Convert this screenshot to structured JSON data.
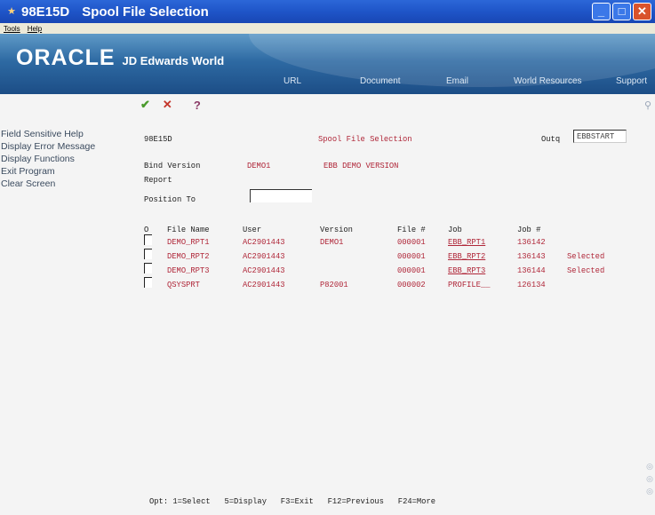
{
  "window": {
    "code": "98E15D",
    "title": "Spool File Selection"
  },
  "menubar": {
    "tools": "Tools",
    "help": "Help"
  },
  "brand": {
    "logo": "ORACLE",
    "product": "JD Edwards World"
  },
  "nav": [
    "URL",
    "Document",
    "Email",
    "World Resources",
    "Support"
  ],
  "sidebar": [
    "Field Sensitive Help",
    "Display Error Message",
    "Display Functions",
    "Exit Program",
    "Clear Screen"
  ],
  "form": {
    "id": "98E15D",
    "title": "Spool File Selection",
    "outq_label": "Outq",
    "outq_value": "EBBSTART",
    "bind_version_label": "Bind Version",
    "bind_version_value": "DEMO1",
    "bind_version_desc": "EBB DEMO VERSION",
    "report_label": "Report",
    "position_to_label": "Position To",
    "position_to_value": ""
  },
  "table": {
    "headers": [
      "O",
      "File Name",
      "User",
      "Version",
      "File #",
      "Job",
      "Job #"
    ],
    "rows": [
      {
        "file_name": "DEMO_RPT1",
        "user": "AC2901443",
        "version": "DEMO1",
        "file_no": "000001",
        "job": "EBB_RPT1",
        "job_no": "136142",
        "status": ""
      },
      {
        "file_name": "DEMO_RPT2",
        "user": "AC2901443",
        "version": "",
        "file_no": "000001",
        "job": "EBB_RPT2",
        "job_no": "136143",
        "status": "Selected"
      },
      {
        "file_name": "DEMO_RPT3",
        "user": "AC2901443",
        "version": "",
        "file_no": "000001",
        "job": "EBB_RPT3",
        "job_no": "136144",
        "status": "Selected"
      },
      {
        "file_name": "QSYSPRT",
        "user": "AC2901443",
        "version": "P82001",
        "file_no": "000002",
        "job": "PROFILE__",
        "job_no": "126134",
        "status": ""
      }
    ]
  },
  "footer": "Opt: 1=Select   5=Display   F3=Exit   F12=Previous   F24=More",
  "icons": {
    "window": "spool-icon",
    "ok": "check-icon",
    "cancel": "x-icon",
    "help": "question-icon",
    "search": "magnifier-icon"
  },
  "colors": {
    "titlebar": "#1f55c8",
    "header": "#2e6aa3",
    "field_text": "#b0283a"
  }
}
